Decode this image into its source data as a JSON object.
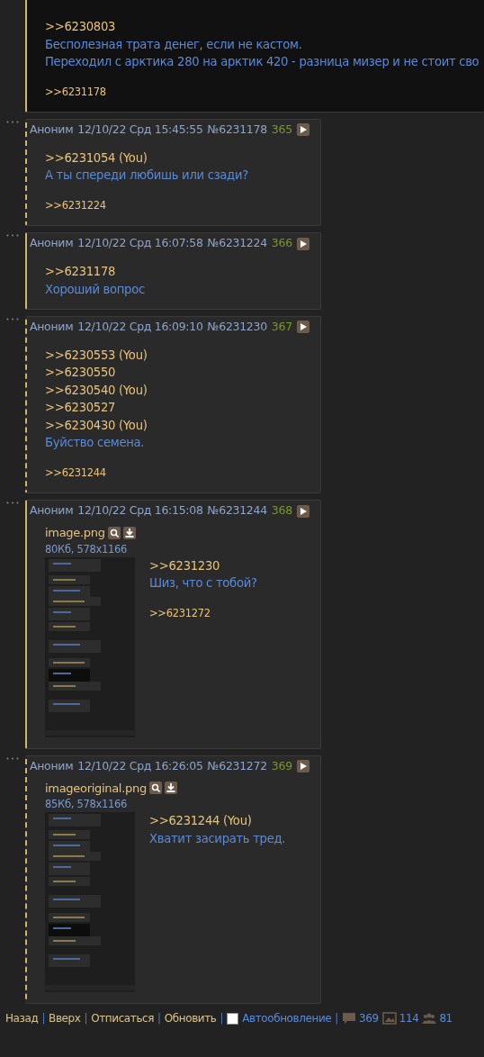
{
  "posts": [
    {
      "highlighted": true,
      "reply_to_you": false,
      "quotes": [
        ">>6230803"
      ],
      "message": [
        "Бесполезная трата денег, если не кастом.",
        "Переходил с арктика 280 на арктик 420 - разница мизер и не стоит сво"
      ],
      "replies": [
        ">>6231178"
      ]
    },
    {
      "highlighted": false,
      "reply_to_you": true,
      "author": "Аноним",
      "date": "12/10/22 Срд 15:45:55",
      "number": "№6231178",
      "index": "365",
      "quotes": [
        ">>6231054 (You)"
      ],
      "message": [
        "А ты спереди любишь или сзади?"
      ],
      "replies": [
        ">>6231224"
      ]
    },
    {
      "highlighted": false,
      "reply_to_you": false,
      "author": "Аноним",
      "date": "12/10/22 Срд 16:07:58",
      "number": "№6231224",
      "index": "366",
      "quotes": [
        ">>6231178"
      ],
      "message": [
        "Хороший вопрос"
      ]
    },
    {
      "highlighted": false,
      "reply_to_you": true,
      "author": "Аноним",
      "date": "12/10/22 Срд 16:09:10",
      "number": "№6231230",
      "index": "367",
      "quotes": [
        ">>6230553 (You)",
        ">>6230550",
        ">>6230540 (You)",
        ">>6230527",
        ">>6230430 (You)"
      ],
      "message": [
        "Буйство семена."
      ],
      "replies": [
        ">>6231244"
      ]
    },
    {
      "highlighted": false,
      "reply_to_you": false,
      "author": "Аноним",
      "date": "12/10/22 Срд 16:15:08",
      "number": "№6231244",
      "index": "368",
      "file": {
        "name": "image.png",
        "info": "80Кб, 578x1166"
      },
      "quotes": [
        ">>6231230"
      ],
      "message": [
        "Шиз, что с тобой?"
      ],
      "replies": [
        ">>6231272"
      ]
    },
    {
      "highlighted": false,
      "reply_to_you": true,
      "author": "Аноним",
      "date": "12/10/22 Срд 16:26:05",
      "number": "№6231272",
      "index": "369",
      "file": {
        "name": "imageoriginal.png",
        "info": "85Кб, 578x1166"
      },
      "quotes": [
        ">>6231244 (You)"
      ],
      "message": [
        "Хватит засирать тред."
      ]
    }
  ],
  "footer": {
    "links": [
      "Назад",
      "Вверх",
      "Отписаться",
      "Обновить"
    ],
    "separator": "|",
    "auto_update": {
      "label": "Автообновление",
      "checked": false
    },
    "stats": [
      {
        "kind": "posts",
        "value": "369"
      },
      {
        "kind": "images",
        "value": "114"
      },
      {
        "kind": "posters",
        "value": "81"
      }
    ]
  }
}
